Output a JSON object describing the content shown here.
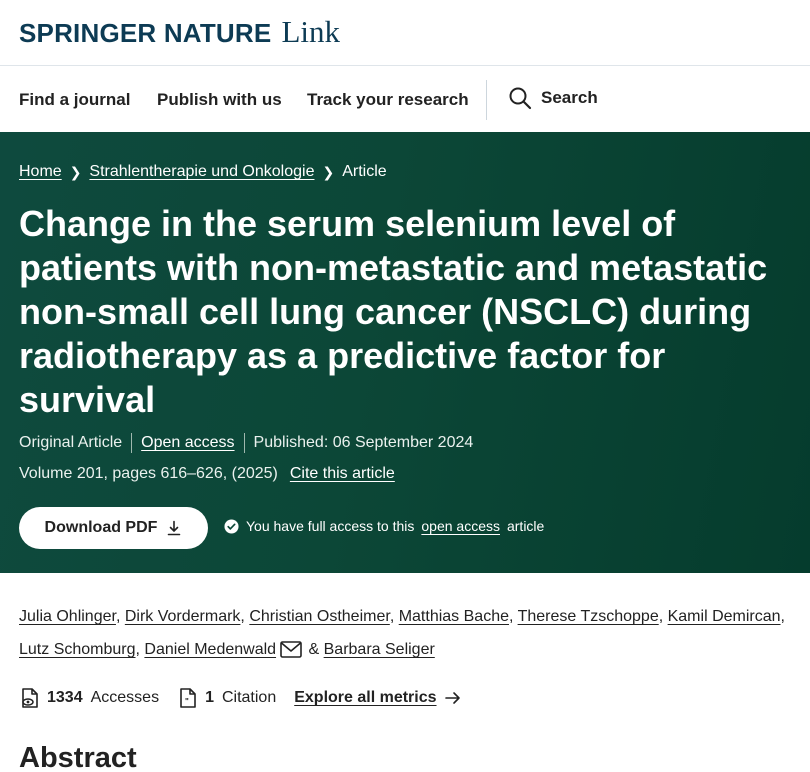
{
  "brand": {
    "name": "SPRINGER NATURE",
    "sub": "Link"
  },
  "nav": {
    "items": [
      "Find a journal",
      "Publish with us",
      "Track your research"
    ],
    "search_label": "Search"
  },
  "breadcrumb": {
    "home": "Home",
    "journal": "Strahlentherapie und Onkologie",
    "current": "Article"
  },
  "article": {
    "title": "Change in the serum selenium level of patients with non-metastatic and metastatic non-small cell lung cancer (NSCLC) during radiotherapy as a predictive factor for survival",
    "type": "Original Article",
    "access": "Open access",
    "published": "Published: 06 September 2024",
    "volume": "Volume 201, pages 616–626, (2025)",
    "cite": "Cite this article"
  },
  "download": {
    "label": "Download PDF",
    "icon": "download-icon"
  },
  "access_note": {
    "prefix": "You have full access to this",
    "link": "open access",
    "suffix": "article",
    "icon": "check-circle-icon"
  },
  "authors": [
    "Julia Ohlinger",
    "Dirk Vordermark",
    "Christian Ostheimer",
    "Matthias Bache",
    "Therese Tzschoppe",
    "Kamil Demircan",
    "Lutz Schomburg",
    "Daniel Medenwald",
    "Barbara Seliger"
  ],
  "author_joiner": "&",
  "metrics": {
    "accesses": "1334",
    "accesses_label": "Accesses",
    "citations": "1",
    "citations_label": "Citation",
    "explore": "Explore all metrics"
  },
  "abstract_heading": "Abstract",
  "colors": {
    "hero": "#0c4737",
    "brand": "#0d3b54",
    "text": "#222222"
  }
}
